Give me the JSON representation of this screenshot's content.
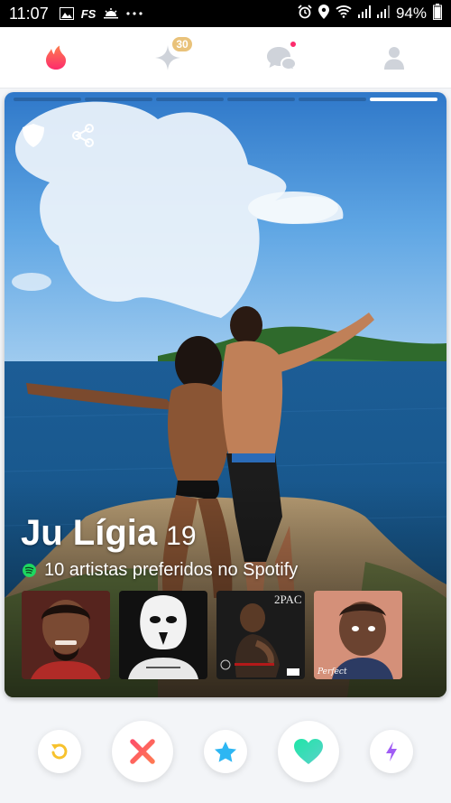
{
  "status_bar": {
    "time": "11:07",
    "fs_label": "FS",
    "battery_percent": "94%"
  },
  "nav": {
    "boost_badge": "30"
  },
  "profile": {
    "name": "Ju Lígia",
    "age": "19",
    "spotify_text": "10 artistas preferidos no Spotify",
    "photo_count": 6,
    "active_photo": 6
  },
  "colors": {
    "like": "#3ee0b2",
    "nope": "#fd5068",
    "super_like": "#2db6f3",
    "rewind": "#f7c22d",
    "boost": "#a05cf5",
    "tinder": "#fd4e6a"
  }
}
